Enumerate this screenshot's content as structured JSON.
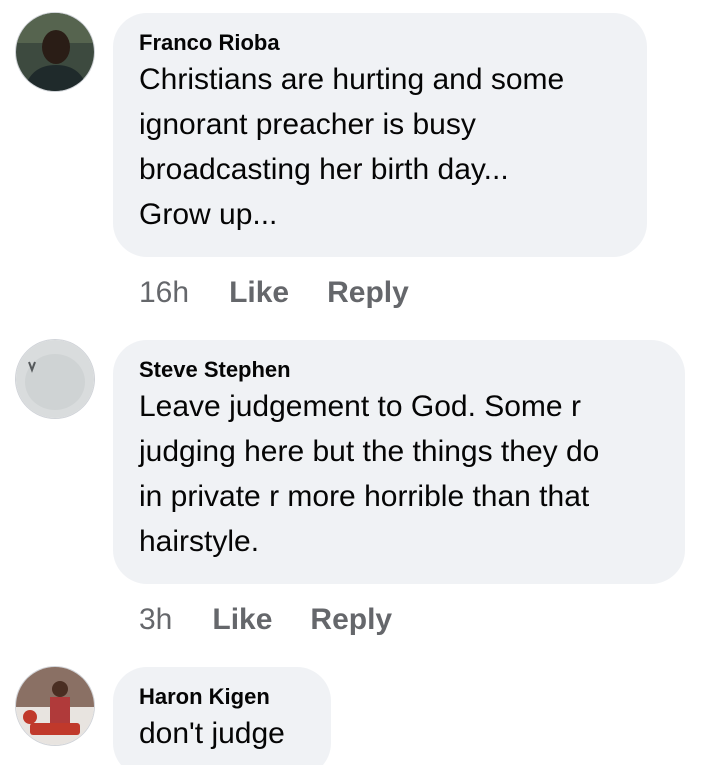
{
  "comments": [
    {
      "author": "Franco Rioba",
      "text": "Christians are hurting and some\nignorant preacher is busy\nbroadcasting  her birth day...\nGrow up...",
      "time": "16h",
      "like_label": "Like",
      "reply_label": "Reply",
      "avatar_icon": "profile-photo"
    },
    {
      "author": "Steve Stephen",
      "text": "Leave judgement to God. Some r\njudging here but the things they do\nin private r more horrible than that\nhairstyle.",
      "time": "3h",
      "like_label": "Like",
      "reply_label": "Reply",
      "avatar_icon": "profile-photo"
    },
    {
      "author": "Haron Kigen",
      "text": "don't judge",
      "avatar_icon": "profile-photo"
    }
  ],
  "colors": {
    "bubble_background": "#f0f2f5",
    "meta_text": "#65676b",
    "body_text": "#050505"
  }
}
